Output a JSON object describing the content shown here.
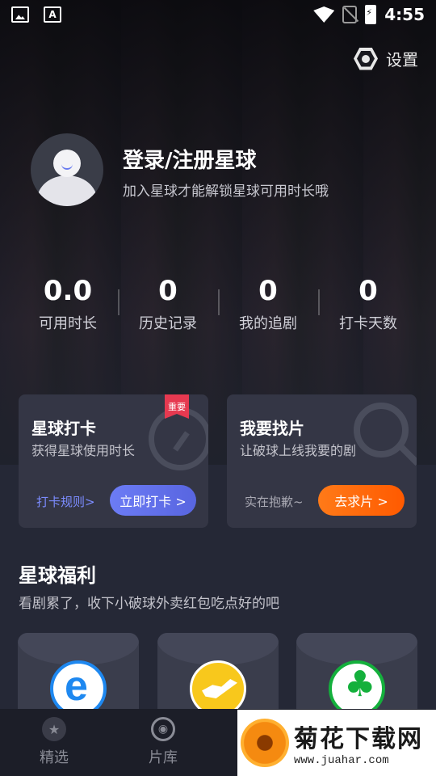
{
  "status_bar": {
    "time": "4:55",
    "a_icon_label": "A"
  },
  "header": {
    "settings_label": "设置"
  },
  "profile": {
    "title": "登录/注册星球",
    "subtitle": "加入星球才能解锁星球可用时长哦"
  },
  "stats": [
    {
      "value": "0.0",
      "label": "可用时长"
    },
    {
      "value": "0",
      "label": "历史记录"
    },
    {
      "value": "0",
      "label": "我的追剧"
    },
    {
      "value": "0",
      "label": "打卡天数"
    }
  ],
  "checkin_card": {
    "badge": "重要",
    "title": "星球打卡",
    "subtitle": "获得星球使用时长",
    "rules_link": "打卡规则>",
    "button": "立即打卡 >"
  },
  "request_card": {
    "title": "我要找片",
    "subtitle": "让破球上线我要的剧",
    "note": "实在抱歉~",
    "button": "去求片 >"
  },
  "benefits": {
    "title": "星球福利",
    "subtitle": "看剧累了，收下小破球外卖红包吃点好的吧"
  },
  "bottom_nav": [
    {
      "label": "精选",
      "icon": "star-icon"
    },
    {
      "label": "片库",
      "icon": "film-reel-icon"
    }
  ],
  "watermark": {
    "title": "菊花下载网",
    "url": "www.juahar.com"
  },
  "colors": {
    "primary_button": "#6c7cf5",
    "secondary_button": "#ff7a18",
    "badge": "#e63950"
  }
}
